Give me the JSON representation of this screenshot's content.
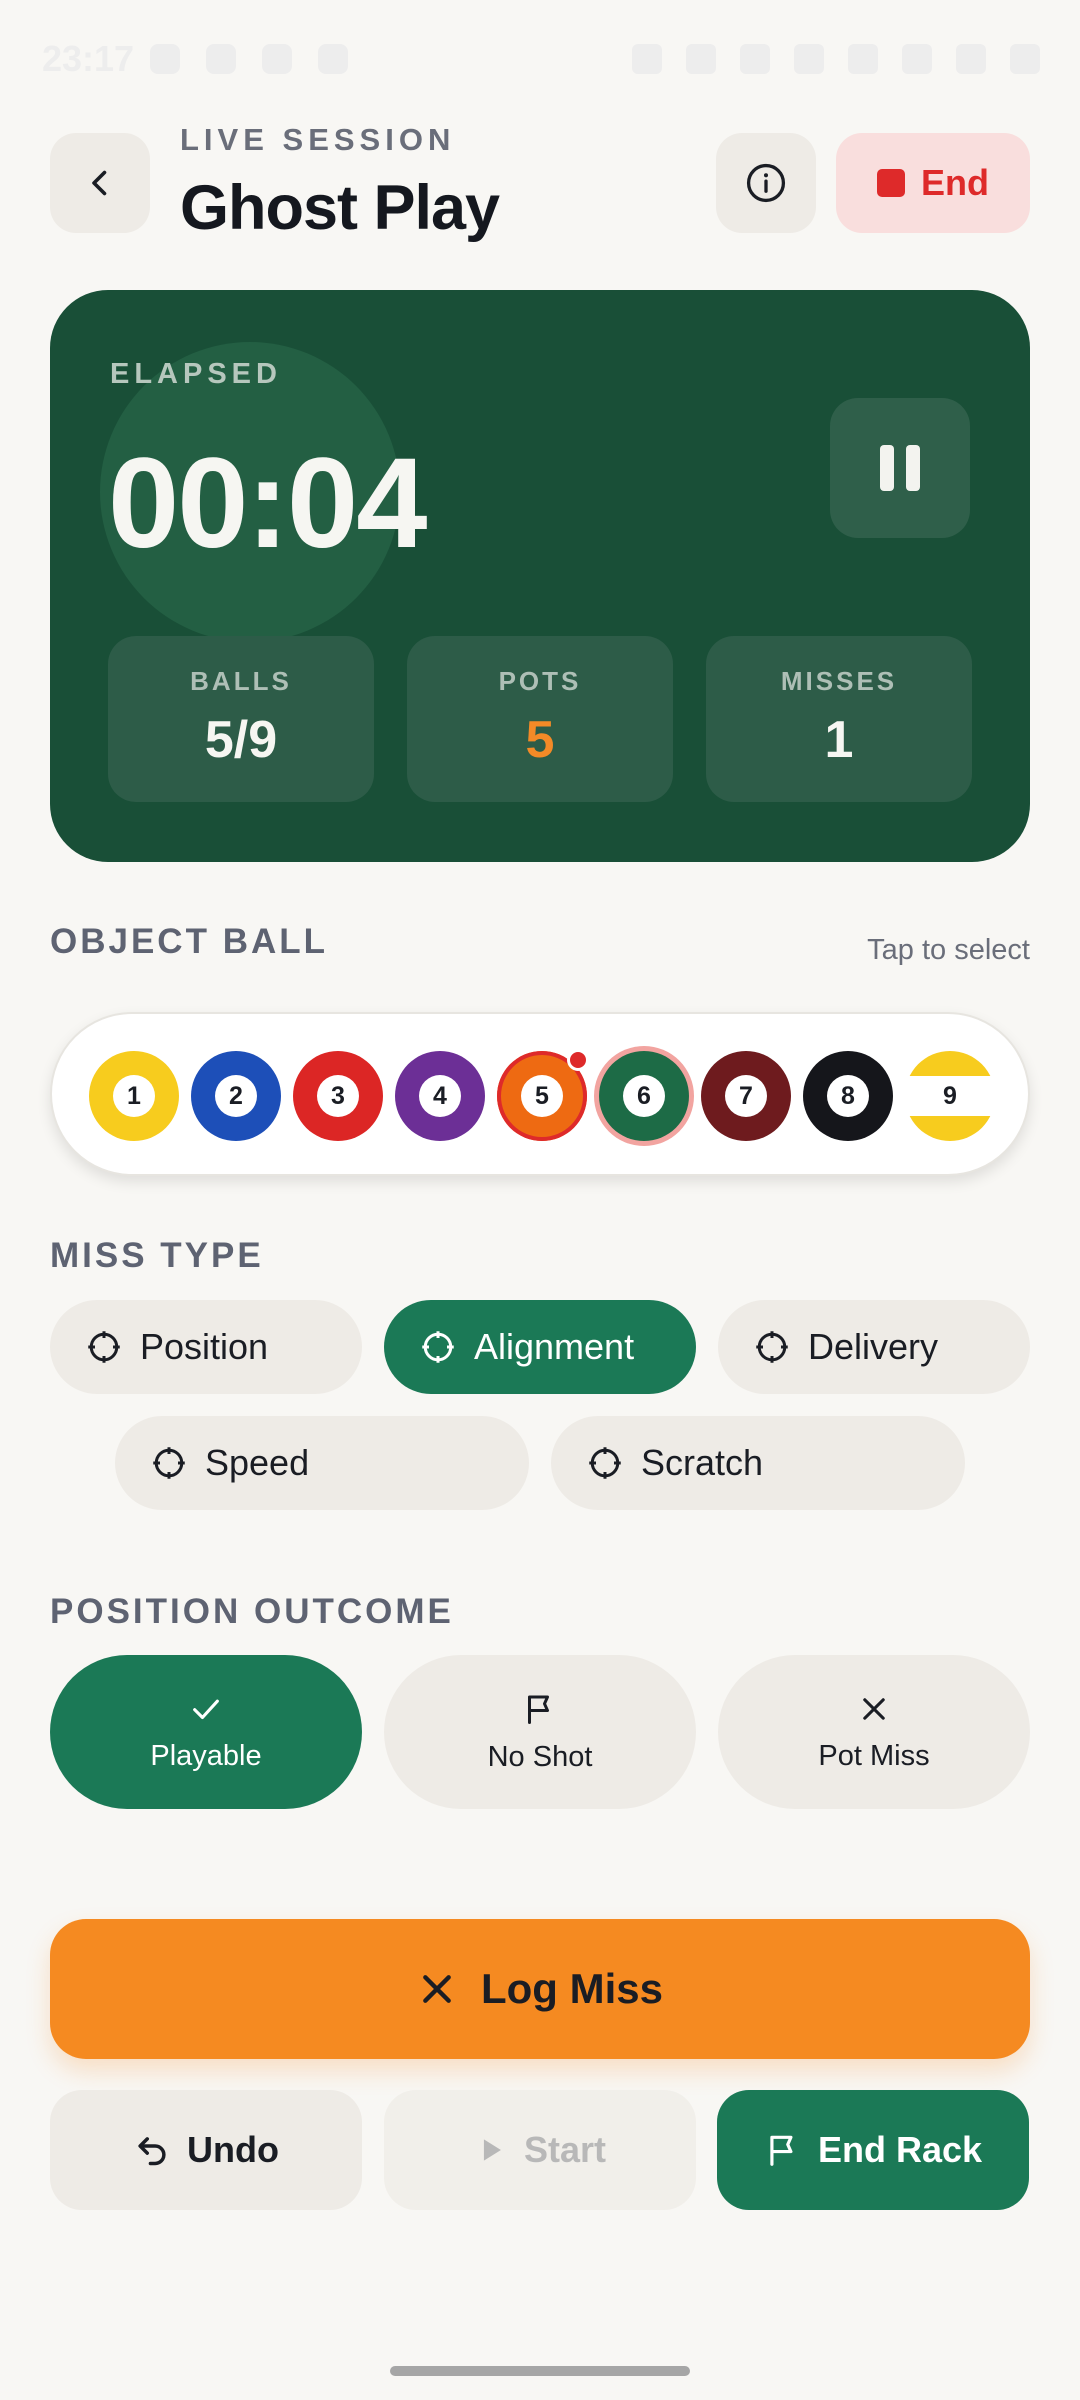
{
  "status_bar": {
    "time": "23:17"
  },
  "header": {
    "eyebrow": "LIVE SESSION",
    "title": "Ghost Play",
    "end_label": "End"
  },
  "timer": {
    "label": "ELAPSED",
    "value": "00:04",
    "stats": [
      {
        "label": "BALLS",
        "value": "5/9"
      },
      {
        "label": "POTS",
        "value": "5"
      },
      {
        "label": "MISSES",
        "value": "1"
      }
    ]
  },
  "object_ball": {
    "title": "OBJECT BALL",
    "hint": "Tap to select",
    "balls": [
      {
        "num": "1",
        "color": "#F7CC1E"
      },
      {
        "num": "2",
        "color": "#1D4FB8"
      },
      {
        "num": "3",
        "color": "#DC2625"
      },
      {
        "num": "4",
        "color": "#6C2F96"
      },
      {
        "num": "5",
        "color": "#EE6A12"
      },
      {
        "num": "6",
        "color": "#1D6B46"
      },
      {
        "num": "7",
        "color": "#6E1B1E"
      },
      {
        "num": "8",
        "color": "#15161B"
      },
      {
        "num": "9",
        "color": "#F7CC1E"
      }
    ],
    "selected": "6"
  },
  "miss_type": {
    "title": "MISS TYPE",
    "options": [
      "Position",
      "Alignment",
      "Delivery",
      "Speed",
      "Scratch"
    ],
    "selected": "Alignment"
  },
  "position_outcome": {
    "title": "POSITION OUTCOME",
    "options": [
      "Playable",
      "No Shot",
      "Pot Miss"
    ],
    "selected": "Playable"
  },
  "actions": {
    "log_miss": "Log Miss",
    "undo": "Undo",
    "start": "Start",
    "end_rack": "End Rack"
  },
  "colors": {
    "card_green": "#194F37",
    "accent_green": "#1B7956",
    "orange": "#F58A21",
    "danger": "#DE2A2A"
  }
}
